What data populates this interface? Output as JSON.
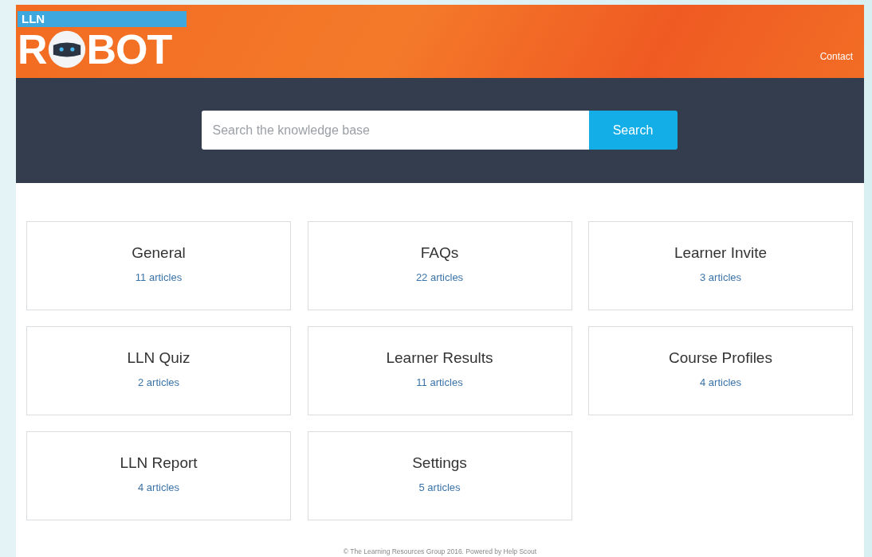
{
  "logo": {
    "badge": "LLN",
    "word_start": "R",
    "word_end": "BOT"
  },
  "nav": [
    {
      "label": "Contact"
    }
  ],
  "search": {
    "placeholder": "Search the knowledge base",
    "button": "Search"
  },
  "categories": [
    {
      "title": "General",
      "count": "11 articles"
    },
    {
      "title": "FAQs",
      "count": "22 articles"
    },
    {
      "title": "Learner Invite",
      "count": "3 articles"
    },
    {
      "title": "LLN Quiz",
      "count": "2 articles"
    },
    {
      "title": "Learner Results",
      "count": "11 articles"
    },
    {
      "title": "Course Profiles",
      "count": "4 articles"
    },
    {
      "title": "LLN Report",
      "count": "4 articles"
    },
    {
      "title": "Settings",
      "count": "5 articles"
    }
  ],
  "footer": "© The Learning Resources Group 2016. Powered by Help Scout"
}
